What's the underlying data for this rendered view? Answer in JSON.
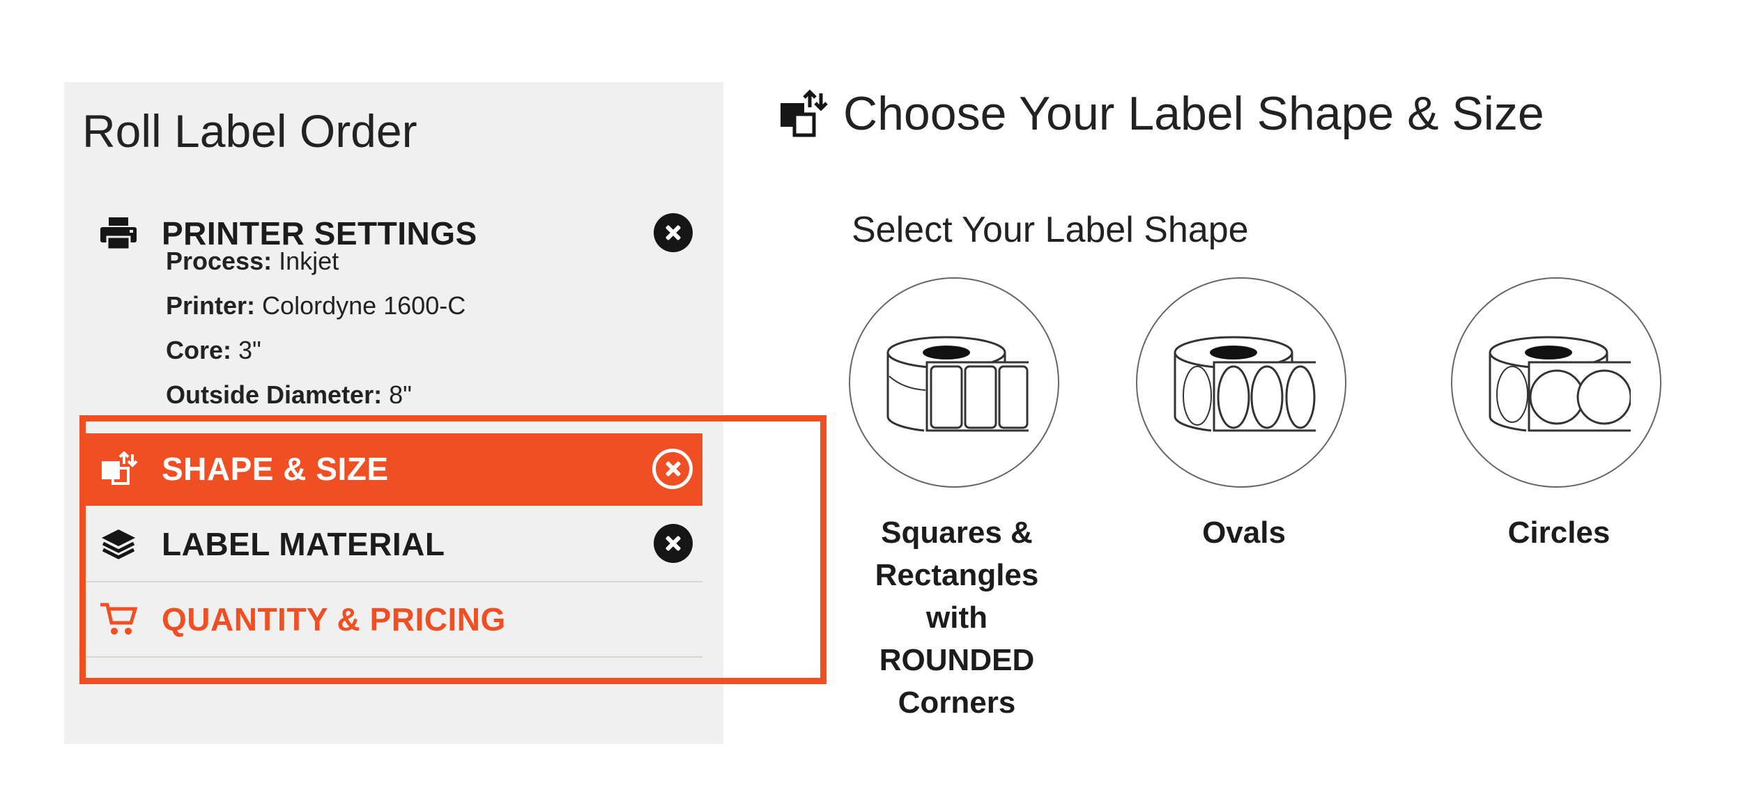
{
  "sidebar": {
    "title": "Roll Label Order",
    "steps": {
      "printer": {
        "label": "PRINTER SETTINGS",
        "icon": "printer-icon",
        "details": [
          {
            "key": "Process:",
            "value": "Inkjet"
          },
          {
            "key": "Printer:",
            "value": "Colordyne 1600-C"
          },
          {
            "key": "Core:",
            "value": "3\""
          },
          {
            "key": "Outside Diameter:",
            "value": "8\""
          }
        ]
      },
      "shape": {
        "label": "SHAPE & SIZE",
        "icon": "shape-size-icon",
        "active": true
      },
      "material": {
        "label": "LABEL MATERIAL",
        "icon": "layers-icon"
      },
      "quantity": {
        "label": "QUANTITY & PRICING",
        "icon": "cart-icon"
      }
    }
  },
  "main": {
    "title": "Choose Your Label Shape & Size",
    "subtitle": "Select Your Label Shape",
    "shapes": [
      {
        "lines": [
          "Squares &",
          "Rectangles",
          "with",
          "ROUNDED",
          "Corners"
        ],
        "icon": "rounded-rectangle-roll-icon"
      },
      {
        "lines": [
          "Ovals"
        ],
        "icon": "oval-roll-icon"
      },
      {
        "lines": [
          "Circles"
        ],
        "icon": "circle-roll-icon"
      }
    ]
  },
  "colors": {
    "accent": "#f04e23",
    "sidebar_bg": "#f0f0f0",
    "text": "#1c1c1c"
  }
}
